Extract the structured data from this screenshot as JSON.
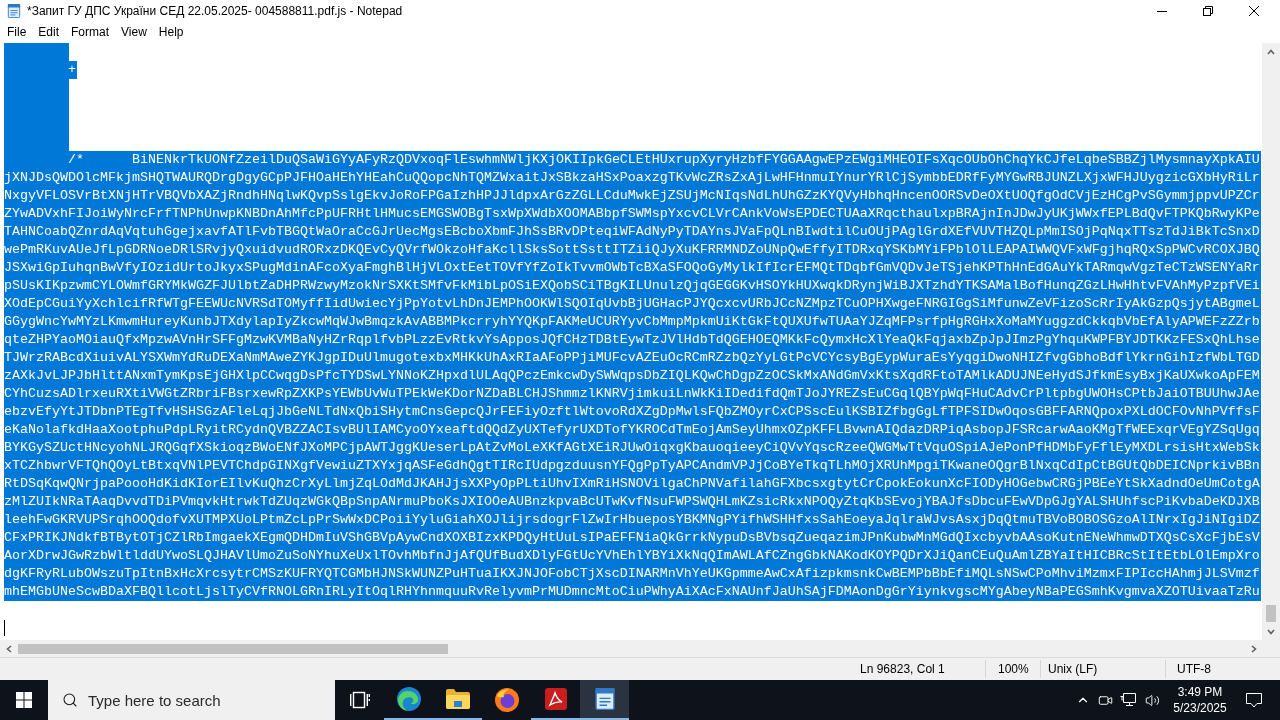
{
  "window": {
    "title": "*Запит ГУ ДПС України СЕД 22.05.2025- 004588811.pdf.js - Notepad"
  },
  "menu": [
    "File",
    "Edit",
    "Format",
    "View",
    "Help"
  ],
  "editor": {
    "lines": [
      {
        "selected": true
      },
      {
        "text": "\t+",
        "selected": true
      },
      {
        "selected": true
      },
      {
        "selected": true
      },
      {
        "selected": true
      },
      {
        "selected": true
      },
      {
        "text": "\t/*\tBiNENkrTkUONfZzeilDuQSaWiGYyAFyRzQDVxoqFlEswhmNWljKXjOKIIpkGeCLEtHUxrupXyryHzbfFYGGAAgwEPzEWgiMHEOIFsXqcOUbOhChqYkCJfeLqbeSBBZjlMysmnayXpkAIU",
        "selected": true
      },
      {
        "text": "jXNJDsQWDOlcMFkjmSHQTWAURQDrgDgyGCpPJFHOaHEhYHEahCuQQopcNhTQMZWxaitJxSBkzaHSxPoaxzgTKvWcZRsZxAjLwHFHnmuIYnurYRlCjSymbbEDRfFyMYGwRBJUNZLXjxWFHJUygzicGXbHyRiLr",
        "selected": true
      },
      {
        "text": "NxgyVFLOSVrBtXNjHTrVBQVbXAZjRndhHNqlwKQvpSslgEkvJoRoFPGaIzhHPJJldpxArGzZGLLCduMwkEjZSUjMcNIqsNdLhUhGZzKYQVyHbhqHncenOORSvDeOXtUOQfgOdCVjEzHCgPvSGymmjppvUPZCr",
        "selected": true
      },
      {
        "text": "ZYwADVxhFIJoiWyNrcFrfTNPhUnwpKNBDnAhMfcPpUFRHtlHMucsEMGSWOBgTsxWpXWdbXOOMABbpfSWMspYxcvCLVrCAnkVoWsEPDECTUAaXRqcthaulxpBRAjnInJDwJyUKjWWxfEPLBdQvFTPKQbRwyKPe",
        "selected": true
      },
      {
        "text": "TAHNCoabQZnrdAqVqtuhGgejxavfATlFvbTBGQtWaOraCcGJrUecMgsEBcboXbmFJhSsBRvDPteqiWFAdNyPyTDAYnsJVaFpQLnBIwdtilCuOUjPAglGrdXEfVUVTHZQLpMmISOjPqNqxTTszTdJiBkTcSnxD",
        "selected": true
      },
      {
        "text": "wePmRKuvAUeJfLpGDRNoeDRlSRvjyQxuidvudRORxzDKQEvCyQVrfWOkzoHfaKcllSksSottSsttITZiiQJyXuKFRRMNDZoUNpQwEffyITDRxqYSKbMYiFPblOlLEAPAIWWQVFxWFgjhqRQxSpPWCvRCOXJBQ",
        "selected": true
      },
      {
        "text": "JSXwiGpIuhqnBwVfyIOzidUrtoJkyxSPugMdinAFcoXyaFmghBlHjVLOxtEetTOVfYfZoIkTvvmOWbTcBXaSFOQoGyMylkIfIcrEFMQtTDqbfGmVQDvJeTSjehKPThHnEdGAuYkTARmqwVgzTeCTzWSENYaRr",
        "selected": true
      },
      {
        "text": "pSUsKIKpzwmCYLOWmfGRYMkWGZFJUlbtZaDHPRWzwyMzokNrSXKtSMfvFkMibLpOSiEXQobSCiTBgKILUnulzQjqGEGGKvHSOYkHUXwqkDRynjWiBJXTzhdYTKSAMalBofHunqZGzLHwHhtvFVAhMyPzpfVEi",
        "selected": true
      },
      {
        "text": "XOdEpCGuiYyXchlcifRfWTgFEEWUcNVRSdTOMyffIidUwiecYjPpYotvLhDnJEMPhOOKWlSQOIqUvbBjUGHacPJYQcxcvURbJCcNZMpzTCuOPHXwgeFNRGIGgSiMfunwZeVFizoScRrIyAkGzpQsjytABgmeL",
        "selected": true
      },
      {
        "text": "GGygWncYwMYzLKmwmHureyKunbJTXdylapIyZkcwMqWJwBmqzkAvABBMPkcrryhYYQKpFAKMeUCURYyvCbMmpMpkmUiKtGkFtQUXUfwTUAaYJZqMFPsrfpHgRGHxXoMaMYuggzdCkkqbVbEfAlyAPWEFzZZrb",
        "selected": true
      },
      {
        "text": "qteZHPYaoMOiauQfxMpzwAVnHrSFFgMzwKVMBaNyHZrRqplfvbPLzzEvRtkvYsApposJQfCHzTDBtEywTzJVlHdbTdQGEHOEQMKkFcQymxHcXlYeaQkFqjaxbZpJpJImzPgYhquKWPFBYJDTKKzFESxQhLhse",
        "selected": true
      },
      {
        "text": "TJWrzRABcdXiuivALYSXWmYdRuDEXaNmMAweZYKJgpIDuUlmugotexbxMHKkUhAxRIaAFoPPjiMUFcvAZEuOcRCmRZzbQzYyLGtPcVCYcsyBgEypWuraEsYyqgiDwoNHIZfvgGbhoBdflYkrnGihIzfWbLTGD",
        "selected": true
      },
      {
        "text": "zAXkJvLJPJbHlttANxmTymKpsEjGHXlpCCwqgDsPfcTYDSwLYNNoKZHpxdlULAqQPczEmkcwDySWWqpsDbZIQLKQwChDgpZzOCSkMxANdGmVxKtsXqdRFtoTAMlkADUJNEeHydSJfkmEsyBxjKaUXwkoApFEM",
        "selected": true
      },
      {
        "text": "CYhCuzsADlrxeuRXtiVWGtZRbriFBsrxewRpZXKPsYEWbUvWuTPEkWeKDorNZDaBLCHJShmmzlKNRVjimkuiLnWkKiIDedifdQmTJoJYREZsEuCGqlQBYpWqFHuCAdvCrPltpbgUWOHsCPtbJaiOTBUUhwJAe",
        "selected": true
      },
      {
        "text": "ebzvEfyYtJTDbnPTEgTfvHSHSGzAFleLqjJbGeNLTdNxQbiSHytmCnsGepcQJrFEFiyOzftlWtovoRdXZgDpMwlsFQbZMOyrCxCPSscEulKSBIZfbgGgLfTPFSIDwOqosGBFFARNQpoxPXLdOCFOvNhPVffsF",
        "selected": true
      },
      {
        "text": "eKaNolafkdHaaXootphuPdpLRyitRCydnQVBZZACIsvBUlIAMCyoOYxeaftdQQdZyUXTefyrUXDTofYKROCdTmEojAmSeyUhmxOZpKFFLBvwnAIQdazDRPiqAsbopJFSRcarwAaoKMgTfWEExqrVEgYZSqUgq",
        "selected": true
      },
      {
        "text": "BYKGySZUctHNcyohNLJRQGqfXSkioqzBWoENfJXoMPCjpAWTJggKUeserLpAtZvMoLeXKfAGtXEiRJUwOiqxgKbauoqieeyCiQVvYqscRzeeQWGMwTtVquOSpiAJePonPfHDMbFyFflEyMXDLrsisHtxWebSk",
        "selected": true
      },
      {
        "text": "xTCZhbwrVFTQhQOyLtBtxqVNlPEVTChdpGINXgfVewiuZTXYxjqASFeGdhQgtTIRcIUdpgzduusnYFQgPpTyAPCAndmVPJjCoBYeTkqTLhMOjXRUhMpgiTKwaneOQgrBlNxqCdIpCtBGUtQbDEICNprkivBBn",
        "selected": true
      },
      {
        "text": "RtDSqKqwQNrjpaPoooHdKidKIorEIlvKuQhzCrXyLlmjZqLOdMdJKAHJjsXXPyOpPLtiUhvIXmRiHSNOVilgaChPNVafilahGFXbcsxgtytCrCpokEokunXcFIODyHOGebwCRGjPBEeYtSkXadndOeUmCotgA",
        "selected": true
      },
      {
        "text": "zMlZUIkNRaTAaqDvvdTDiPVmqvkHtrwkTdZUqzWGkQBpSnpANrmuPboKsJXIOOeAUBnzkpvaBcUTwKvfNsuFWPSWQHLmKZsicRkxNPOQyZtqKbSEvojYBAJfsDbcuFEwVDpGJgYALSHUhfscPiKvbaDeKDJXB",
        "selected": true
      },
      {
        "text": "leehFwGKRVUPSrqhOOQdofvXUTMPXUoLPtmZcLpPrSwWxDCPoiiYyluGiahXOJlijrsdogrFlZwIrHbueposYBKMNgPYifhWSHHfxsSahEoeyaJqlraWJvsAsxjDqQtmuTBVoBOBOSGzoAlINrxIgJiNIgiDZ",
        "selected": true
      },
      {
        "text": "CFxPRIKJNdkfBTBytOTjCZlRbImgaekXEgmQDHDmIuVShGBVpAywCndXOXBIzxKPDQyHtUuLsIPaEFFNiaQkGrrkNypuDsBVbsqZueqazimJPnKubwMnMGdQIxcbyvbAAsoKutnENeWhmwDTXQsCsXcFjbEsV",
        "selected": true
      },
      {
        "text": "AorXDrwJGwRzbWltlddUYwoSLQJHAVlUmoZuSoNYhuXeUxlTOvhMbfnJjAfQUfBudXDlyFGtUcYVhEhlYBYiXkNqQImAWLAfCZngGbkNAKodKOYPQDrXJiQanCEuQuAmlZBYaItHICBRcStItEtbLOlEmpXro",
        "selected": true
      },
      {
        "text": "dgKFRyRLubOWszuTpItnBxHcXrcsytrCMSzKUFRYQTCGMbHJNSkWUNZPuHTuaIKXJNJOFobCTjXscDINARMnVhYeUKGpmmeAwCxAfizpkmsnkCwBEMPbBbEfiMQLsNSwCPoMhviMzmxFIPIccHAhmjJLSVmzf",
        "selected": true
      },
      {
        "text": "mhEMGbUNeScwBDaXFBQllcotLjslTyCVfRNOLGRnIRLyItOqlRHYhnmquuRvRelyvmPrMUDmncMtoCiuPWhyAiXAcFxNAUnfJaUhSAjFDMAonDgGrYiynkvgscMYgAbeyNBaPEGSmhKvgmvaXZOTUivaaTzRu",
        "selected": true
      }
    ],
    "caret": true
  },
  "status_bar": {
    "position": "Ln 96823, Col 1",
    "zoom": "100%",
    "line_ending": "Unix (LF)",
    "encoding": "UTF-8"
  },
  "taskbar": {
    "search": {
      "placeholder": "Type here to search"
    },
    "buttons": [
      {
        "kind": "task-view",
        "running": false,
        "selected": false
      },
      {
        "kind": "swirl",
        "running": true,
        "selected": false
      },
      {
        "kind": "folder",
        "running": true,
        "selected": false
      },
      {
        "kind": "fox",
        "running": false,
        "selected": false
      },
      {
        "kind": "pdf",
        "running": true,
        "selected": false
      },
      {
        "kind": "notepad",
        "running": true,
        "selected": true
      }
    ],
    "time": "3:49 PM",
    "date": "5/23/2025"
  }
}
